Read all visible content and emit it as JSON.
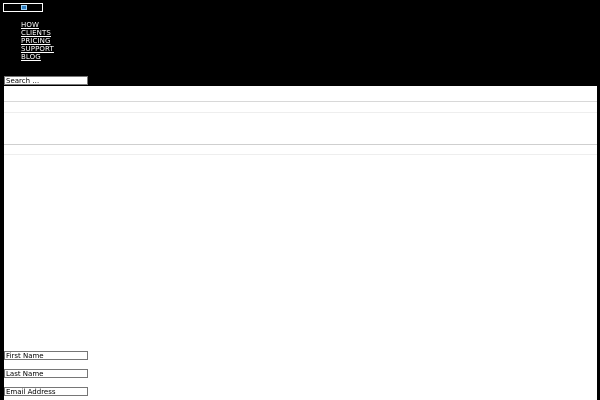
{
  "header": {
    "logo_icon": "site-logo-icon",
    "nav": [
      {
        "label": "HOW"
      },
      {
        "label": "CLIENTS"
      },
      {
        "label": "PRICING"
      },
      {
        "label": "SUPPORT"
      },
      {
        "label": "BLOG"
      }
    ]
  },
  "search": {
    "placeholder": "Search …"
  },
  "form": {
    "first_name_placeholder": "First Name",
    "last_name_placeholder": "Last Name",
    "email_placeholder": "Email Address"
  },
  "colors": {
    "background": "#000000",
    "content": "#ffffff",
    "logo_accent": "#2f7fc1"
  }
}
